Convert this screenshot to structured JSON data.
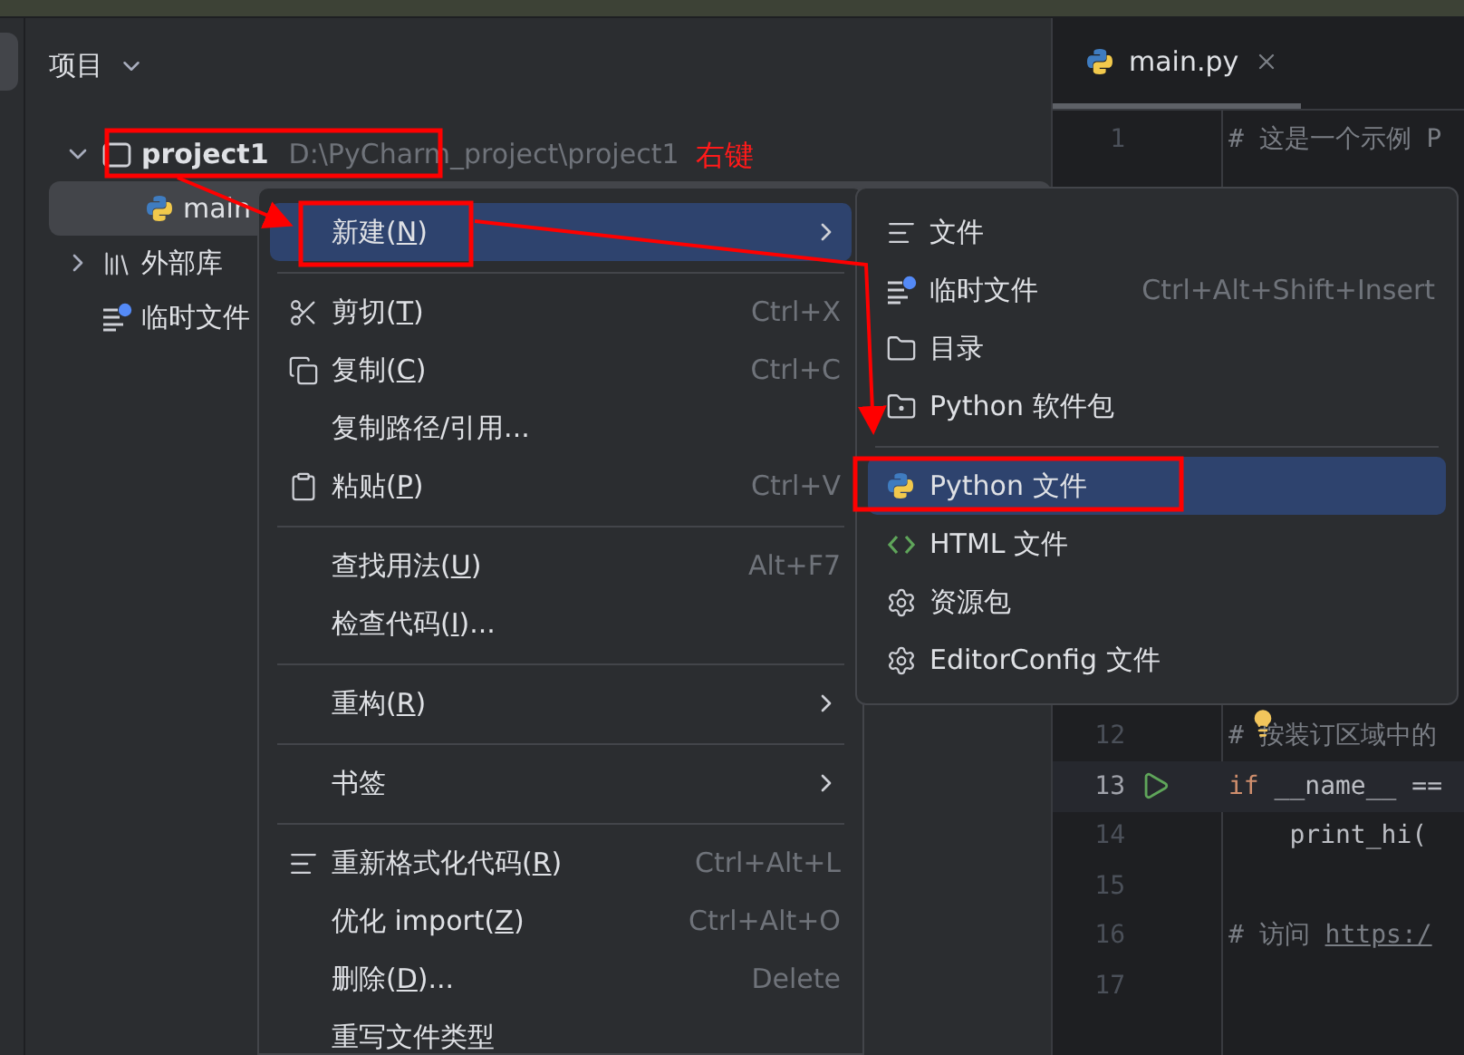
{
  "project_panel": {
    "title": "项目",
    "tree": [
      {
        "name": "project1",
        "path": "D:\\PyCharm_project\\project1",
        "kind": "project",
        "expanded": true,
        "selected": false,
        "children": [
          {
            "name": "main",
            "kind": "python",
            "selected": true
          }
        ]
      },
      {
        "name": "外部库",
        "kind": "library",
        "expanded": false,
        "selected": false
      },
      {
        "name": "临时文件",
        "kind": "scratch",
        "selected": false
      }
    ]
  },
  "editor": {
    "tabs": [
      {
        "label": "main.py",
        "selected": true
      }
    ],
    "lines": [
      {
        "number": "1",
        "tokens": [
          {
            "text": "# 这是一个示例 P",
            "kind": "comment"
          }
        ]
      },
      {
        "number": "12",
        "bulb": true,
        "tokens": [
          {
            "text": "# ",
            "kind": "comment"
          },
          {
            "text": "按装订区域中的",
            "kind": "comment"
          }
        ]
      },
      {
        "number": "13",
        "run": true,
        "current": true,
        "tokens": [
          {
            "text": "if",
            "kind": "keyword"
          },
          {
            "text": " __name__ ==",
            "kind": "plain"
          }
        ]
      },
      {
        "number": "14",
        "tokens": [
          {
            "text": "    print_hi(",
            "kind": "plain"
          }
        ]
      },
      {
        "number": "15"
      },
      {
        "number": "16",
        "tokens": [
          {
            "text": "# 访问 ",
            "kind": "comment"
          },
          {
            "text": "https:/",
            "kind": "link"
          }
        ]
      },
      {
        "number": "17"
      }
    ]
  },
  "context_menu": [
    {
      "kind": "item",
      "before": "新建(",
      "key": "N",
      "after": ")",
      "submenu": true,
      "selected": true
    },
    {
      "kind": "separator"
    },
    {
      "kind": "item",
      "before": "剪切(",
      "key": "T",
      "after": ")",
      "shortcut": "Ctrl+X",
      "selected": false
    },
    {
      "kind": "item",
      "before": "复制(",
      "key": "C",
      "after": ")",
      "shortcut": "Ctrl+C",
      "selected": false
    },
    {
      "kind": "item",
      "before": "复制路径/引用...",
      "selected": false
    },
    {
      "kind": "item",
      "before": "粘贴(",
      "key": "P",
      "after": ")",
      "shortcut": "Ctrl+V",
      "selected": false
    },
    {
      "kind": "separator"
    },
    {
      "kind": "item",
      "before": "查找用法(",
      "key": "U",
      "after": ")",
      "shortcut": "Alt+F7",
      "selected": false
    },
    {
      "kind": "item",
      "before": "检查代码(",
      "key": "I",
      "after": ")...",
      "selected": false
    },
    {
      "kind": "separator"
    },
    {
      "kind": "item",
      "before": "重构(",
      "key": "R",
      "after": ")",
      "submenu": true,
      "selected": false
    },
    {
      "kind": "separator"
    },
    {
      "kind": "item",
      "before": "书签",
      "submenu": true,
      "selected": false
    },
    {
      "kind": "separator"
    },
    {
      "kind": "item",
      "before": "重新格式化代码(",
      "key": "R",
      "after": ")",
      "shortcut": "Ctrl+Alt+L",
      "selected": false
    },
    {
      "kind": "item",
      "before": "优化 import(",
      "key": "Z",
      "after": ")",
      "shortcut": "Ctrl+Alt+O",
      "selected": false
    },
    {
      "kind": "item",
      "before": "删除(",
      "key": "D",
      "after": ")...",
      "shortcut": "Delete",
      "selected": false
    },
    {
      "kind": "item",
      "before": "重写文件类型",
      "selected": false
    }
  ],
  "submenu": [
    {
      "kind": "item",
      "label": "文件",
      "selected": false
    },
    {
      "kind": "item",
      "label": "临时文件",
      "shortcut": "Ctrl+Alt+Shift+Insert",
      "selected": false
    },
    {
      "kind": "item",
      "label": "目录",
      "selected": false
    },
    {
      "kind": "item",
      "label": "Python 软件包",
      "selected": false
    },
    {
      "kind": "separator"
    },
    {
      "kind": "item",
      "label": "Python 文件",
      "selected": true
    },
    {
      "kind": "item",
      "label": "HTML 文件",
      "selected": false
    },
    {
      "kind": "item",
      "label": "资源包",
      "selected": false
    },
    {
      "kind": "item",
      "label": "EditorConfig 文件",
      "selected": false
    }
  ],
  "annotation": {
    "label": "右键"
  }
}
